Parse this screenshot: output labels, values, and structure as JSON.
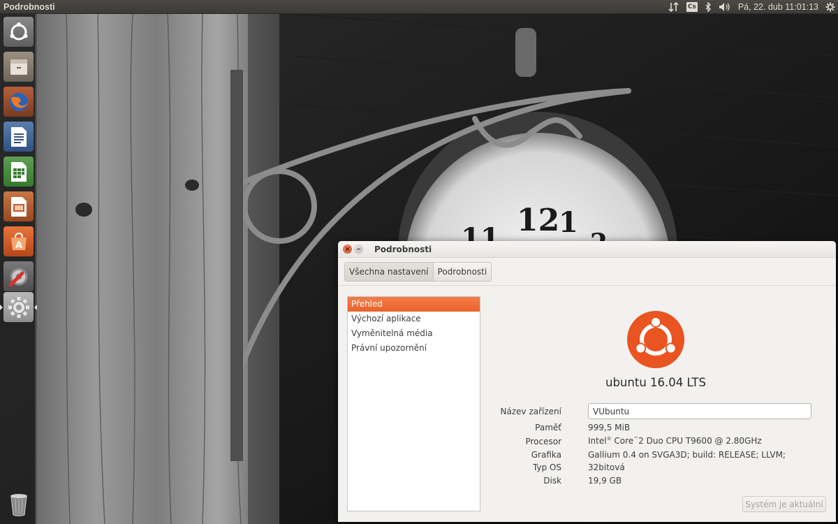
{
  "panel": {
    "title": "Podrobnosti",
    "keyboard_layout": "Cs",
    "clock": "Pá, 22. dub 11:01:13"
  },
  "launcher": {
    "items": [
      {
        "name": "dash-home",
        "icon": "ubuntu-dash-icon"
      },
      {
        "name": "files",
        "icon": "files-icon"
      },
      {
        "name": "firefox",
        "icon": "firefox-icon"
      },
      {
        "name": "writer",
        "icon": "libreoffice-writer-icon"
      },
      {
        "name": "calc",
        "icon": "libreoffice-calc-icon"
      },
      {
        "name": "impress",
        "icon": "libreoffice-impress-icon"
      },
      {
        "name": "software-center",
        "icon": "software-center-icon"
      },
      {
        "name": "system-tools",
        "icon": "system-tools-icon"
      },
      {
        "name": "system-settings",
        "icon": "system-settings-icon"
      },
      {
        "name": "trash",
        "icon": "trash-icon"
      }
    ]
  },
  "window": {
    "title": "Podrobnosti",
    "breadcrumbs": [
      "Všechna nastavení",
      "Podrobnosti"
    ],
    "sidebar": [
      "Přehled",
      "Výchozí aplikace",
      "Vyměnitelná média",
      "Právní upozornění"
    ],
    "selected_sidebar": "Přehled",
    "distro": "ubuntu 16.04 LTS",
    "accent": "#e95420",
    "info": {
      "device_label": "Název zařízení",
      "device_value": "VUbuntu",
      "memory_label": "Paměť",
      "memory_value": "999,5 MiB",
      "processor_label": "Procesor",
      "processor_value_1": "Intel",
      "processor_sup_1": "®",
      "processor_value_2": " Core",
      "processor_sup_2": "™",
      "processor_value_3": "2 Duo CPU T9600 @ 2.80GHz",
      "graphics_label": "Grafika",
      "graphics_value": "Gallium 0.4 on SVGA3D; build: RELEASE;  LLVM;",
      "os_type_label": "Typ OS",
      "os_type_value": "32bitová",
      "disk_label": "Disk",
      "disk_value": "19,9 GB"
    },
    "update_button": "Systém je aktuální"
  }
}
